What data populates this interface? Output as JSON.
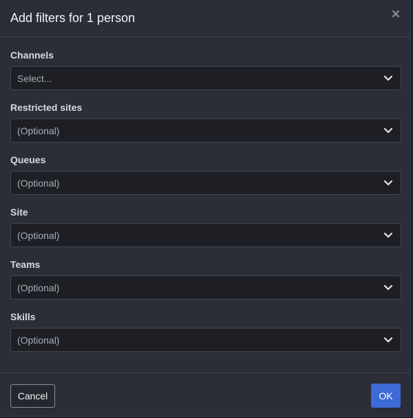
{
  "dialog": {
    "title": "Add filters for 1 person",
    "close_icon": "close-icon"
  },
  "fields": [
    {
      "label": "Channels",
      "value": "Select..."
    },
    {
      "label": "Restricted sites",
      "value": "(Optional)"
    },
    {
      "label": "Queues",
      "value": "(Optional)"
    },
    {
      "label": "Site",
      "value": "(Optional)"
    },
    {
      "label": "Teams",
      "value": "(Optional)"
    },
    {
      "label": "Skills",
      "value": "(Optional)"
    }
  ],
  "footer": {
    "cancel_label": "Cancel",
    "ok_label": "OK"
  },
  "colors": {
    "background": "#2b2e37",
    "input_background": "#1d1f25",
    "primary_button": "#3e6ad8"
  }
}
